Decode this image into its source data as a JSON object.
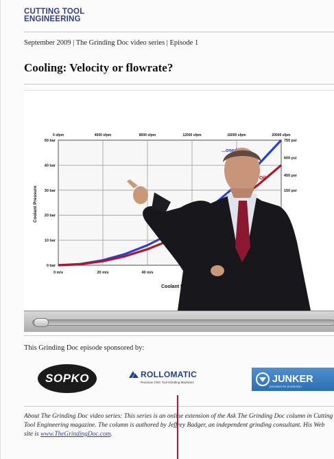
{
  "header": {
    "logo_line1": "CUTTING TOOL",
    "logo_line2": "ENGINEERING",
    "issue_line": "September 2009 | The Grinding Doc video series | Episode 1",
    "title": "Cooling: Velocity or flowrate?"
  },
  "video": {
    "chart_data": {
      "type": "line",
      "xlabel": "Coolant Exit",
      "ylabel": "Coolant Pressure",
      "x_bottom_ticks": [
        "0 m/s",
        "20 m/s",
        "40 m/s"
      ],
      "x_top_ticks": [
        "0 sfpm",
        "4000 sfpm",
        "8000 sfpm",
        "12000 sfpm",
        "16000 sfpm",
        "20000 sfpm"
      ],
      "y_left_ticks": [
        "0 bar",
        "10 bar",
        "20 bar",
        "30 bar",
        "40 bar",
        "50 bar"
      ],
      "y_right_ticks": [
        "150 psi",
        "450 psi",
        "600 psi",
        "750 psi"
      ],
      "ylim": [
        0,
        50
      ],
      "grid": true,
      "series": [
        {
          "name": "...oned",
          "color": "#2a3fd8",
          "x": [
            0,
            10,
            20,
            30,
            40,
            50,
            60,
            70,
            80,
            90,
            100
          ],
          "y": [
            0,
            0.5,
            2,
            4.5,
            8,
            12.5,
            18,
            24.5,
            32,
            40.5,
            50
          ]
        },
        {
          "name": "Oil",
          "color": "#b0162a",
          "x": [
            0,
            10,
            20,
            30,
            40,
            50,
            60,
            70,
            80,
            90,
            100
          ],
          "y": [
            0,
            0.4,
            1.6,
            3.6,
            6.4,
            10,
            14.4,
            19.6,
            25.6,
            32.4,
            40
          ]
        }
      ]
    },
    "colors": {
      "blue_series": "#2a3fd8",
      "red_series": "#b0162a",
      "suit": "#17171c",
      "tie": "#8c1730"
    }
  },
  "sponsors": {
    "label": "This Grinding Doc episode sponsored by:",
    "sopko": "SOPKO",
    "rollomatic": "ROLLOMATIC",
    "rollomatic_tagline": "Precision CNC Tool Grinding Machines",
    "junker": "JUNKER",
    "junker_tagline": "precision for production"
  },
  "about": {
    "label": "About The Grinding Doc video series:",
    "text": " This series is an online extension of the Ask The Grinding Doc column in Cutting Tool Engineering magazine. The column is authored by Jeffrey Badger, an independent grinding consultant. His Web site is ",
    "link": "www.TheGrindingDoc.com",
    "end": "."
  }
}
